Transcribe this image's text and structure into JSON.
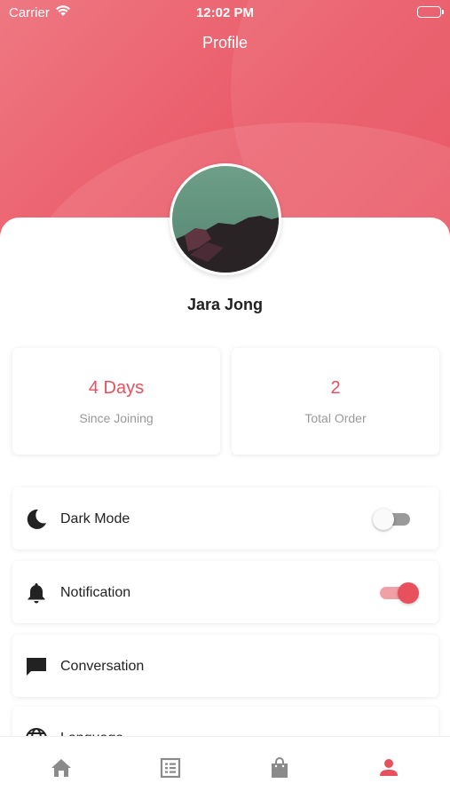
{
  "status_bar": {
    "carrier": "Carrier",
    "time": "12:02 PM"
  },
  "header": {
    "title": "Profile"
  },
  "profile": {
    "name": "Jara Jong"
  },
  "stats": [
    {
      "value": "4 Days",
      "label": "Since Joining"
    },
    {
      "value": "2",
      "label": "Total Order"
    }
  ],
  "settings": [
    {
      "label": "Dark Mode",
      "icon": "moon-icon",
      "toggle": false
    },
    {
      "label": "Notification",
      "icon": "bell-icon",
      "toggle": true
    },
    {
      "label": "Conversation",
      "icon": "chat-icon"
    },
    {
      "label": "Language",
      "icon": "globe-icon"
    }
  ],
  "bottom_nav": [
    {
      "icon": "home-icon",
      "active": false
    },
    {
      "icon": "list-icon",
      "active": false
    },
    {
      "icon": "shopping-bag-icon",
      "active": false
    },
    {
      "icon": "person-icon",
      "active": true
    }
  ],
  "colors": {
    "accent": "#e8505e",
    "header_gradient": [
      "#ee7882",
      "#e84a59"
    ],
    "nav_inactive": "#8a8a8a"
  }
}
